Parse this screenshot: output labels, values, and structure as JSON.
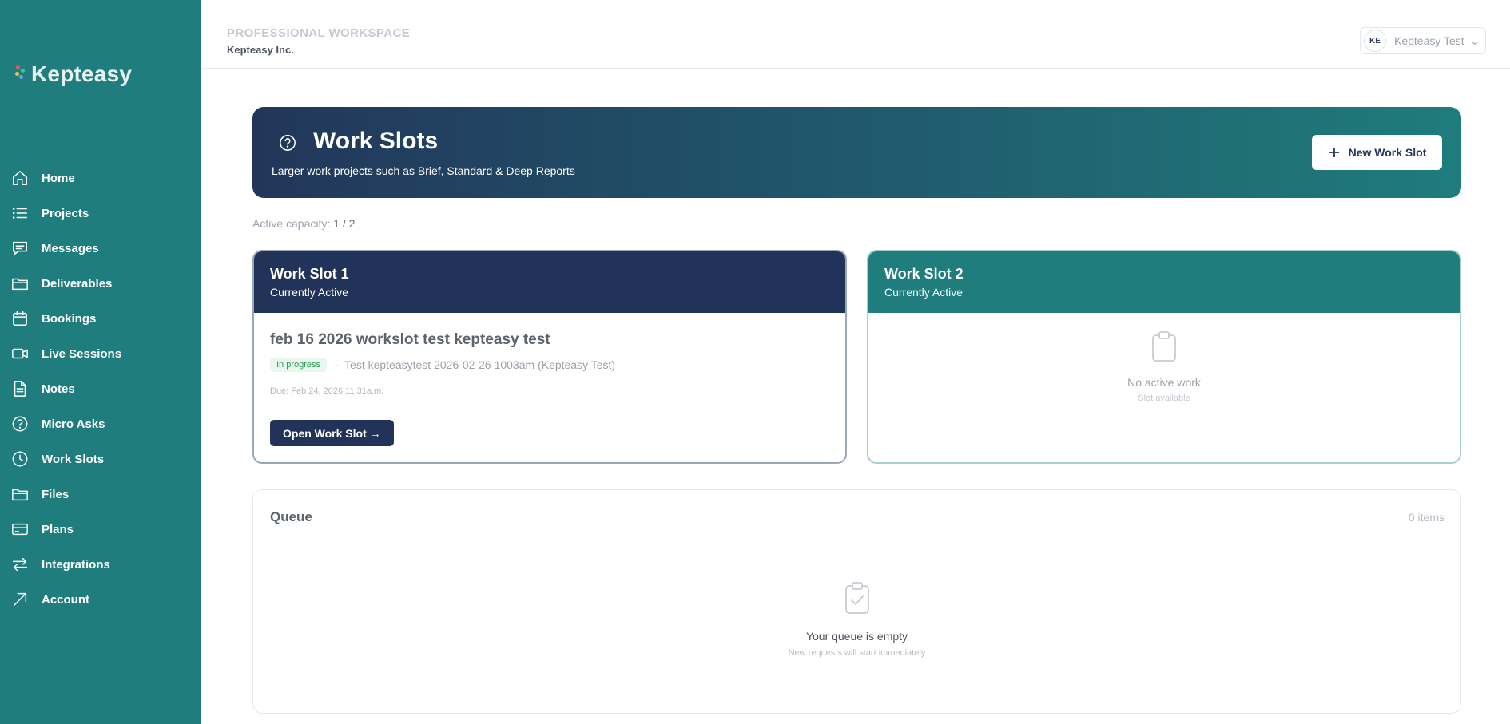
{
  "app": {
    "name": "Kepteasy"
  },
  "brand": {
    "sidebar_bg": "#1f7d7d",
    "navy": "#22335a"
  },
  "sidebar": {
    "items": [
      {
        "label": "Home",
        "icon": "home-icon"
      },
      {
        "label": "Projects",
        "icon": "list-icon"
      },
      {
        "label": "Messages",
        "icon": "message-icon"
      },
      {
        "label": "Deliverables",
        "icon": "folder-icon"
      },
      {
        "label": "Bookings",
        "icon": "calendar-icon"
      },
      {
        "label": "Live Sessions",
        "icon": "video-icon"
      },
      {
        "label": "Notes",
        "icon": "document-icon"
      },
      {
        "label": "Micro Asks",
        "icon": "help-circle-icon"
      },
      {
        "label": "Work Slots",
        "icon": "clock-icon"
      },
      {
        "label": "Files",
        "icon": "folder-icon"
      },
      {
        "label": "Plans",
        "icon": "credit-card-icon"
      },
      {
        "label": "Integrations",
        "icon": "arrows-swap-icon"
      },
      {
        "label": "Account",
        "icon": "arrow-up-right-icon"
      }
    ]
  },
  "header": {
    "workspace_label": "PROFESSIONAL WORKSPACE",
    "workspace_name": "Kepteasy Inc.",
    "user_initials": "KE",
    "user_name": "Kepteasy Test"
  },
  "hero": {
    "title": "Work Slots",
    "subtitle": "Larger work projects such as Brief, Standard & Deep Reports",
    "new_button": "New Work Slot"
  },
  "capacity": {
    "label": "Active capacity:",
    "value": "1 / 2"
  },
  "slots": [
    {
      "title": "Work Slot 1",
      "status": "Currently Active",
      "job_title": "feb 16 2026 workslot test kepteasy test",
      "badge": "In progress",
      "separator": "·",
      "job_desc": "Test kepteasytest 2026-02-26 1003am (Kepteasy Test)",
      "due": "Due: Feb 24, 2026 11:31a.m.",
      "open_button": "Open Work Slot →"
    },
    {
      "title": "Work Slot 2",
      "status": "Currently Active",
      "empty_title": "No active work",
      "empty_sub": "Slot available"
    }
  ],
  "queue": {
    "title": "Queue",
    "count": "0 items",
    "empty_title": "Your queue is empty",
    "empty_sub": "New requests will start immediately"
  }
}
